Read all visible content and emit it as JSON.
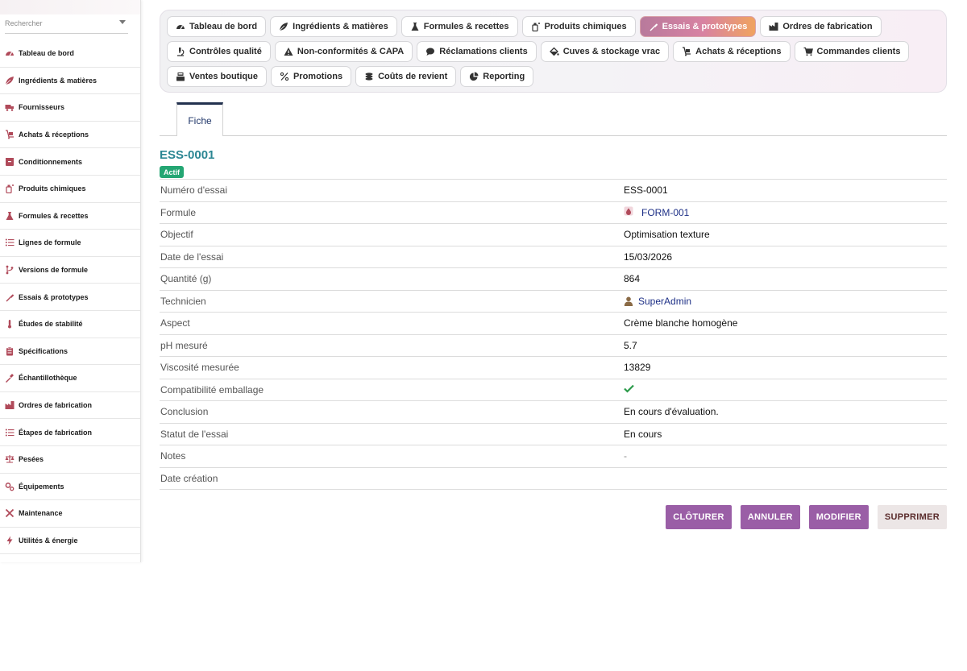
{
  "search": {
    "placeholder": "Rechercher"
  },
  "sidebar": {
    "items": [
      {
        "label": "Tableau de bord",
        "icon": "dashboard-icon"
      },
      {
        "label": "Ingrédients & matières",
        "icon": "leaf-icon"
      },
      {
        "label": "Fournisseurs",
        "icon": "truck-icon"
      },
      {
        "label": "Achats & réceptions",
        "icon": "cart-dolly-icon"
      },
      {
        "label": "Conditionnements",
        "icon": "box-icon"
      },
      {
        "label": "Produits chimiques",
        "icon": "chemical-bottle-icon"
      },
      {
        "label": "Formules & recettes",
        "icon": "flask-icon"
      },
      {
        "label": "Lignes de formule",
        "icon": "list-icon"
      },
      {
        "label": "Versions de formule",
        "icon": "branch-icon"
      },
      {
        "label": "Essais & prototypes",
        "icon": "pipette-icon"
      },
      {
        "label": "Études de stabilité",
        "icon": "thermometer-icon"
      },
      {
        "label": "Spécifications",
        "icon": "clipboard-icon"
      },
      {
        "label": "Échantillothèque",
        "icon": "eyedropper-icon"
      },
      {
        "label": "Ordres de fabrication",
        "icon": "factory-icon"
      },
      {
        "label": "Étapes de fabrication",
        "icon": "list-icon"
      },
      {
        "label": "Pesées",
        "icon": "scale-icon"
      },
      {
        "label": "Équipements",
        "icon": "gears-icon"
      },
      {
        "label": "Maintenance",
        "icon": "tools-icon"
      },
      {
        "label": "Utilités & énergie",
        "icon": "bolt-icon"
      }
    ]
  },
  "modules": {
    "row1": [
      {
        "label": "Tableau de bord",
        "icon": "dashboard-icon"
      },
      {
        "label": "Ingrédients & matières",
        "icon": "leaf-icon"
      },
      {
        "label": "Formules & recettes",
        "icon": "flask-icon"
      },
      {
        "label": "Produits chimiques",
        "icon": "chemical-bottle-icon"
      },
      {
        "label": "Essais & prototypes",
        "icon": "pipette-icon",
        "active": true
      },
      {
        "label": "Ordres de fabrication",
        "icon": "factory-icon"
      }
    ],
    "row2": [
      {
        "label": "Contrôles qualité",
        "icon": "microscope-icon"
      },
      {
        "label": "Non-conformités & CAPA",
        "icon": "warning-icon"
      },
      {
        "label": "Réclamations clients",
        "icon": "comment-icon"
      },
      {
        "label": "Cuves & stockage vrac",
        "icon": "fill-drip-icon"
      },
      {
        "label": "Achats & réceptions",
        "icon": "cart-dolly-icon"
      },
      {
        "label": "Commandes clients",
        "icon": "shopping-cart-icon"
      }
    ],
    "row3": [
      {
        "label": "Ventes boutique",
        "icon": "cash-register-icon"
      },
      {
        "label": "Promotions",
        "icon": "percent-icon"
      },
      {
        "label": "Coûts de revient",
        "icon": "coins-icon"
      },
      {
        "label": "Reporting",
        "icon": "pie-chart-icon"
      }
    ]
  },
  "tabs": {
    "fiche": "Fiche"
  },
  "record": {
    "title": "ESS-0001",
    "status_badge": "Actif",
    "fields": [
      {
        "label": "Numéro d'essai",
        "value": "ESS-0001"
      },
      {
        "label": "Formule",
        "value": "FORM-001",
        "type": "link"
      },
      {
        "label": "Objectif",
        "value": "Optimisation texture"
      },
      {
        "label": "Date de l'essai",
        "value": "15/03/2026"
      },
      {
        "label": "Quantité (g)",
        "value": "864"
      },
      {
        "label": "Technicien",
        "value": "SuperAdmin",
        "type": "user"
      },
      {
        "label": "Aspect",
        "value": "Crème blanche homogène"
      },
      {
        "label": "pH mesuré",
        "value": "5.7"
      },
      {
        "label": "Viscosité mesurée",
        "value": "13829"
      },
      {
        "label": "Compatibilité emballage",
        "value": "",
        "type": "check"
      },
      {
        "label": "Conclusion",
        "value": "En cours d'évaluation."
      },
      {
        "label": "Statut de l'essai",
        "value": "En cours"
      },
      {
        "label": "Notes",
        "value": "-",
        "type": "muted"
      },
      {
        "label": "Date création",
        "value": ""
      }
    ]
  },
  "actions": {
    "cloturer": "CLÔTURER",
    "annuler": "ANNULER",
    "modifier": "MODIFIER",
    "supprimer": "SUPPRIMER"
  },
  "colors": {
    "accent": "#9a5ea6",
    "title": "#2b8693",
    "badge": "#24a673",
    "link": "#1d2f86",
    "icon": "#b04a5a"
  }
}
